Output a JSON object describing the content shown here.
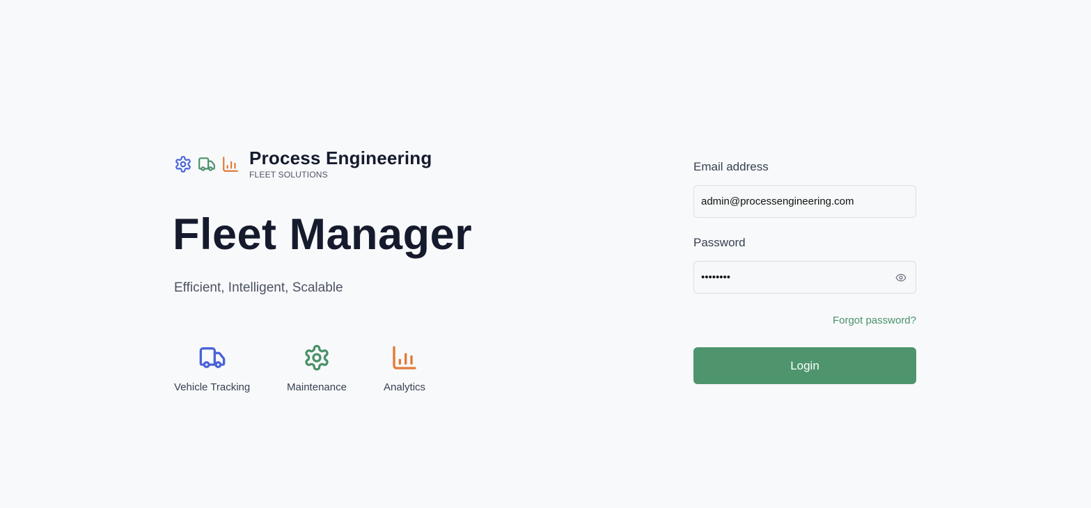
{
  "brand": {
    "title": "Process Engineering",
    "subtitle": "FLEET SOLUTIONS",
    "icons": [
      "gear-icon",
      "truck-icon",
      "bar-chart-icon"
    ]
  },
  "hero": {
    "title": "Fleet Manager",
    "tagline": "Efficient, Intelligent, Scalable"
  },
  "features": [
    {
      "label": "Vehicle Tracking",
      "icon": "truck-icon",
      "color": "#4a63d8"
    },
    {
      "label": "Maintenance",
      "icon": "gear-icon",
      "color": "#4a9168"
    },
    {
      "label": "Analytics",
      "icon": "bar-chart-icon",
      "color": "#e07b35"
    }
  ],
  "login_form": {
    "email_label": "Email address",
    "email_value": "admin@processengineering.com",
    "password_label": "Password",
    "password_value": "password",
    "forgot_label": "Forgot password?",
    "submit_label": "Login"
  },
  "colors": {
    "background": "#f8f9fb",
    "primary_green": "#4e956d",
    "accent_blue": "#4a63d8",
    "accent_orange": "#e07b35",
    "text_dark": "#151a2d"
  }
}
